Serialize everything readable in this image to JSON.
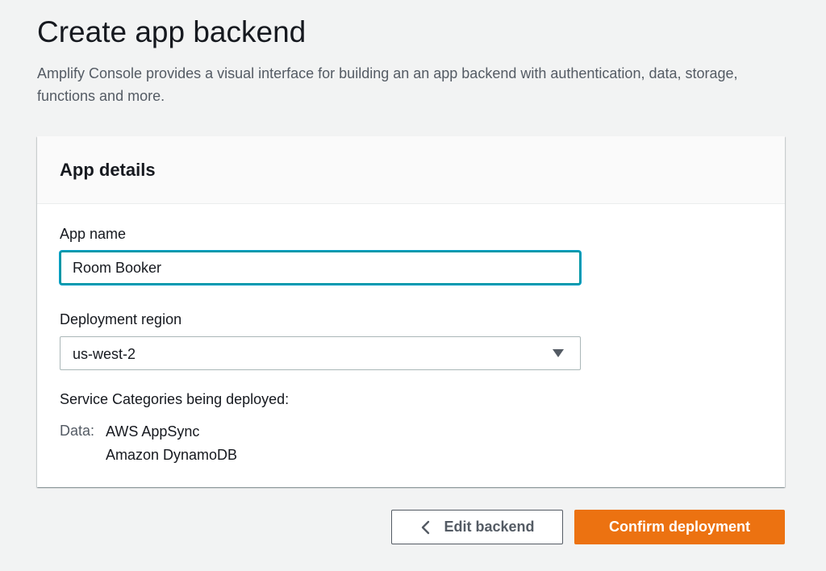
{
  "page": {
    "title": "Create app backend",
    "description": "Amplify Console provides a visual interface for building an an app backend with authentication, data, storage, functions and more."
  },
  "panel": {
    "title": "App details",
    "app_name": {
      "label": "App name",
      "value": "Room Booker"
    },
    "region": {
      "label": "Deployment region",
      "selected": "us-west-2"
    },
    "categories": {
      "heading": "Service Categories being deployed:",
      "items": [
        {
          "key": "Data:",
          "values": [
            "AWS AppSync",
            "Amazon DynamoDB"
          ]
        }
      ]
    }
  },
  "actions": {
    "edit_label": "Edit backend",
    "confirm_label": "Confirm deployment"
  },
  "colors": {
    "primary": "#ec7211",
    "focus": "#00a1c9",
    "background": "#f2f3f3"
  },
  "icons": {
    "select_caret": "caret-down-icon",
    "back": "chevron-left-icon"
  }
}
